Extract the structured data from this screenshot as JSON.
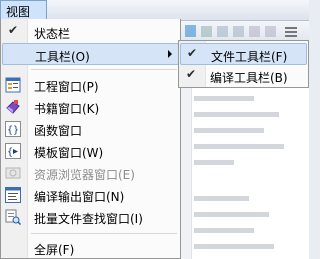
{
  "menubar": {
    "view_label": "视图(V)"
  },
  "view_menu": {
    "items": [
      {
        "label": "状态栏",
        "checked": true
      },
      {
        "label": "工具栏(O)",
        "has_submenu": true
      },
      {
        "label": "工程窗口(P)",
        "icon": "project-window-icon"
      },
      {
        "label": "书籍窗口(K)",
        "icon": "book-window-icon"
      },
      {
        "label": "函数窗口",
        "icon": "function-window-icon"
      },
      {
        "label": "模板窗口(W)",
        "icon": "template-window-icon"
      },
      {
        "label": "资源浏览器窗口(E)",
        "icon": "resource-browser-icon",
        "disabled": true
      },
      {
        "label": "编译输出窗口(N)",
        "icon": "compile-output-icon"
      },
      {
        "label": "批量文件查找窗口(I)",
        "icon": "batch-find-icon"
      },
      {
        "label": "全屏(F)"
      }
    ]
  },
  "toolbar_submenu": {
    "items": [
      {
        "label": "文件工具栏(F)",
        "checked": true
      },
      {
        "label": "编译工具栏(B)",
        "checked": true
      }
    ]
  },
  "colors": {
    "highlight": "#d5e4f7",
    "highlight_border": "#9dbde3"
  }
}
